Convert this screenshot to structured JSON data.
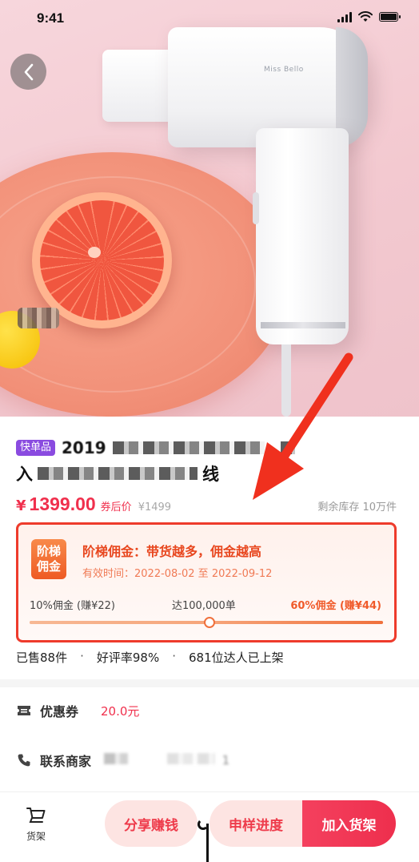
{
  "status_bar": {
    "time": "9:41"
  },
  "hero": {
    "brand_text": "Miss Bello"
  },
  "product": {
    "tag": "快单品",
    "title_line1": "2019",
    "title_line2_start": "入",
    "title_line2_end": "线",
    "currency": "¥",
    "price": "1399.00",
    "price_after_label": "券后价",
    "original_price": "¥1499",
    "stock": "剩余库存 10万件"
  },
  "commission": {
    "badge_line1": "阶梯",
    "badge_line2": "佣金",
    "title": "阶梯佣金：带货越多，佣金越高",
    "date": "有效时间：2022-08-02 至 2022-09-12",
    "tier_low": "10%佣金 (赚¥22)",
    "tier_mid": "达100,000单",
    "tier_high": "60%佣金 (赚¥44)",
    "progress_fraction": 0.51
  },
  "stats": {
    "sold": "已售88件",
    "rating": "好评率98%",
    "creators": "681位达人已上架",
    "separator": "·"
  },
  "coupon": {
    "label": "优惠券",
    "value": "20.0元"
  },
  "contact": {
    "label": "联系商家",
    "value": "1"
  },
  "bottom": {
    "shelf_label": "货架",
    "share_label": "分享赚钱",
    "sample_label": "申样进度",
    "add_label": "加入货架"
  },
  "colors": {
    "accent": "#f0304d",
    "commission_border": "#ee3b2c",
    "tag_purple": "#8a4be0"
  }
}
